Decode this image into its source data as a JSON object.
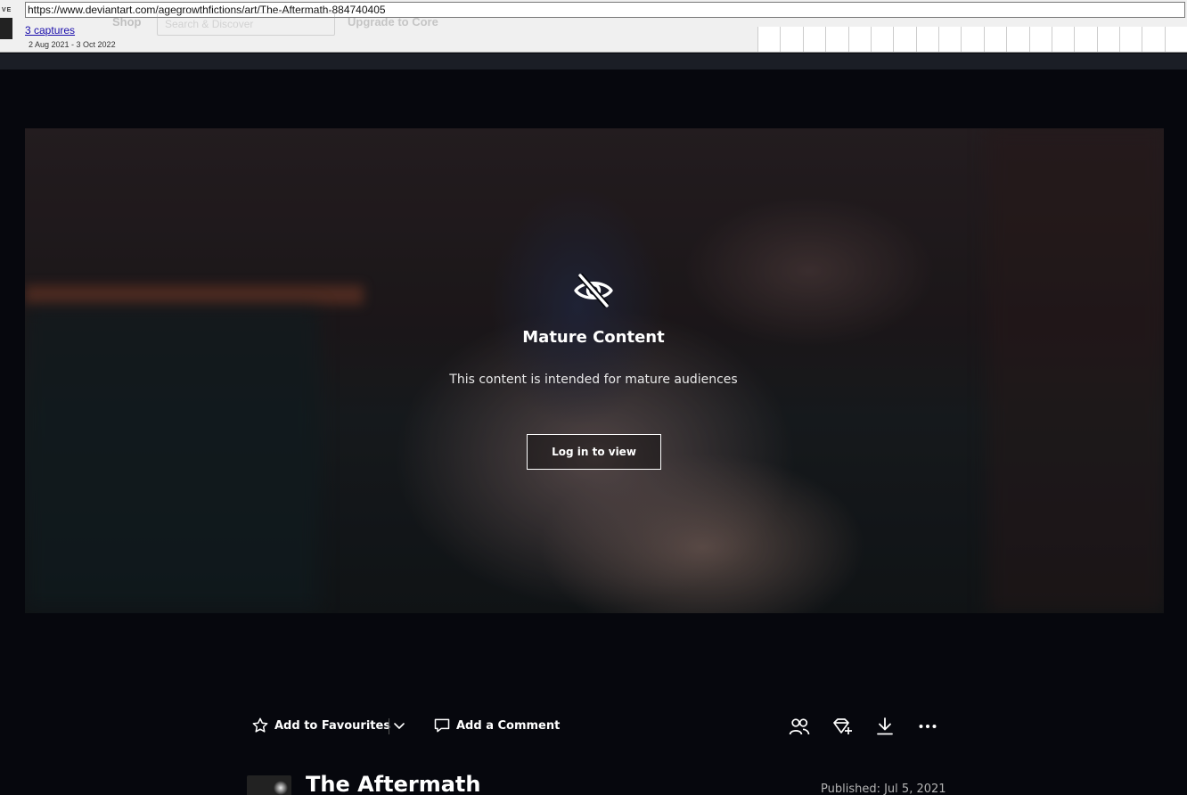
{
  "wayback": {
    "url": "https://www.deviantart.com/agegrowthfictions/art/The-Aftermath-884740405",
    "captures_link": "3 captures",
    "date_range": "2 Aug 2021 - 3 Oct 2022"
  },
  "site_header": {
    "shop_label": "Shop",
    "search_placeholder": "Search & Discover",
    "upgrade_label": "Upgrade to Core"
  },
  "mature_gate": {
    "icon": "eye-slash-icon",
    "title": "Mature Content",
    "description": "This content is intended for mature audiences",
    "login_button": "Log in to view"
  },
  "actions": {
    "favourite_label": "Add to Favourites",
    "comment_label": "Add a Comment",
    "icons": [
      "star-icon",
      "chevron-down-icon",
      "comment-icon",
      "watch-users-icon",
      "gift-icon",
      "download-icon",
      "more-icon"
    ]
  },
  "deviation": {
    "title": "The Aftermath",
    "published": "Published: Jul 5, 2021"
  },
  "colors": {
    "page_bg": "#06070d",
    "toolbar_bg": "#f0f0f0",
    "link": "#1a0dab",
    "text": "#ffffff",
    "muted": "#b3b3b3"
  }
}
